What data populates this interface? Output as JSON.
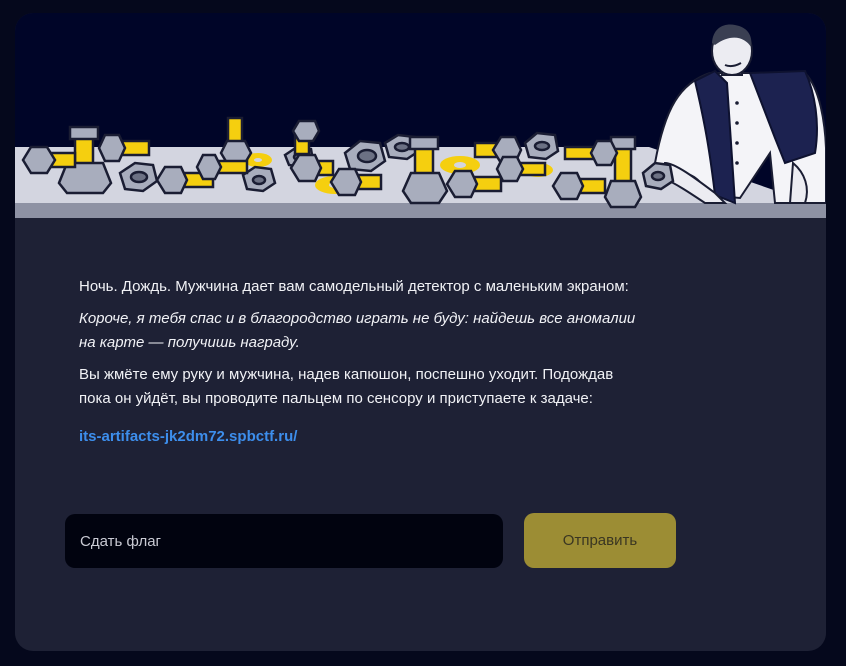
{
  "task": {
    "intro": "Ночь. Дождь. Мужчина дает вам самодельный детектор с маленьким экраном:",
    "quote": "Короче, я тебя спас и в благородство играть не буду: найдешь все аномалии на карте — получишь награду.",
    "outro": "Вы жмёте ему руку и мужчина, надев капюшон, поспешно уходит. Подождав пока он уйдёт, вы проводите пальцем по сенсору и приступаете к задаче:",
    "link_text": "its-artifacts-jk2dm72.spbctf.ru/"
  },
  "form": {
    "flag_placeholder": "Сдать флаг",
    "flag_value": "",
    "submit_label": "Отправить"
  },
  "colors": {
    "page_bg": "#05081c",
    "card_bg": "#1e2135",
    "banner_bg": "#000528",
    "link": "#3d8eec",
    "button_bg": "#9c8d34",
    "input_bg": "#01030f"
  },
  "illustration": {
    "subject": "man-leaning-on-workbench-with-bolts-and-nuts"
  }
}
